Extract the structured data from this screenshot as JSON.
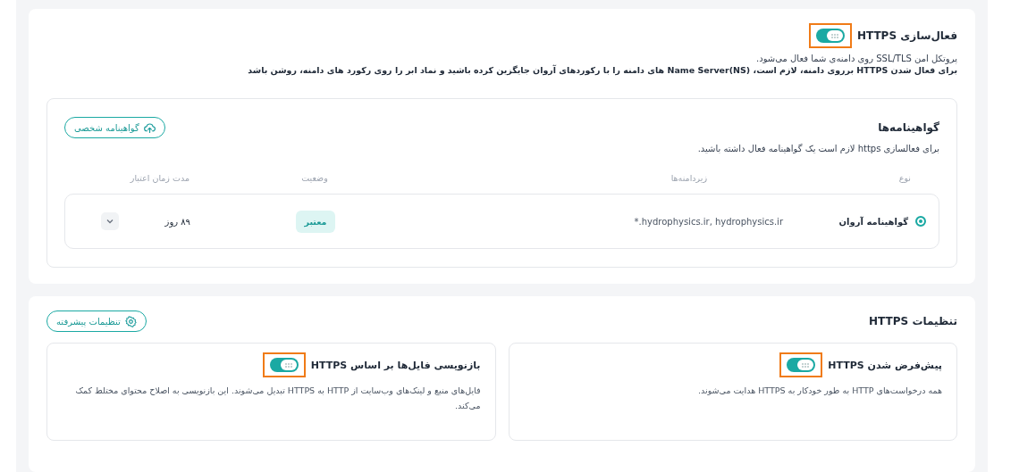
{
  "https_card": {
    "title": "فعال‌سازی HTTPS",
    "toggle": {
      "on": true,
      "highlighted": true
    },
    "description": "پروتکل امن SSL/TLS روی دامنه‌ی شما فعال می‌شود.",
    "note": "برای فعال شدن HTTPS برروی دامنه، لازم است، Name Server(NS) های دامنه را با رکوردهای آروان جایگزین کرده باشید و نماد ابر را روی رکورد های دامنه، روشن باشد"
  },
  "certificates": {
    "title": "گواهینامه‌ها",
    "button": "گواهینامه شخصی",
    "description": "برای فعالسازی https لازم است یک گواهینامه فعال داشته باشید.",
    "columns": [
      "نوع",
      "زیردامنه‌ها",
      "وضعیت",
      "مدت زمان اعتبار"
    ],
    "rows": [
      {
        "type": "گواهینامه آروان",
        "selected": true,
        "subdomains": "*.hydrophysics.ir, hydrophysics.ir",
        "status": "معتبر",
        "validity": "۸۹ روز"
      }
    ]
  },
  "settings": {
    "title": "تنظیمات HTTPS",
    "button": "تنظیمات پیشرفته",
    "options": [
      {
        "title": "پیش‌فرض شدن HTTPS",
        "on": true,
        "highlighted": true,
        "description": "همه درخواست‌های HTTP به طور خودکار به HTTPS هدایت می‌شوند."
      },
      {
        "title": "بازنویسی فایل‌ها بر اساس HTTPS",
        "on": true,
        "highlighted": true,
        "description": "فایل‌های منبع و لینک‌های وب‌سایت از HTTP به HTTPS تبدیل می‌شوند. این بازنویسی به اصلاح محتوای مختلط کمک می‌کند."
      }
    ]
  }
}
